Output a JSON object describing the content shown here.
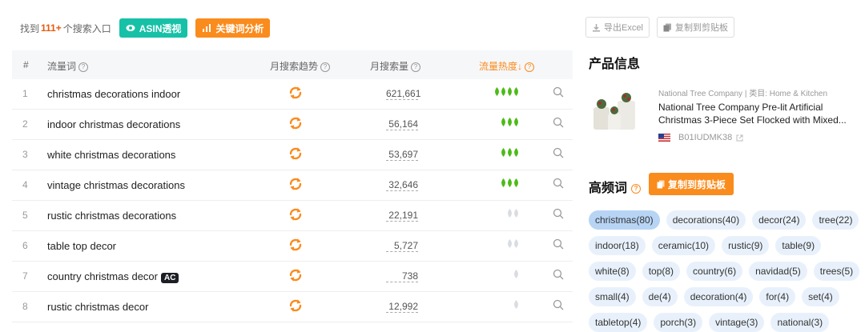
{
  "summary": {
    "prefix": "找到",
    "count": "111+",
    "suffix": "个搜索入口"
  },
  "buttons": {
    "asin": "ASIN透视",
    "keyword": "关键词分析",
    "export": "导出Excel",
    "copy": "复制到剪贴板"
  },
  "table": {
    "headers": {
      "idx": "#",
      "keyword": "流量词",
      "trend": "月搜索趋势",
      "volume": "月搜索量",
      "heat": "流量热度↓"
    },
    "rows": [
      {
        "idx": "1",
        "keyword": "christmas decorations indoor",
        "volume": "621,661",
        "heat": 4,
        "badge": ""
      },
      {
        "idx": "2",
        "keyword": "indoor christmas decorations",
        "volume": "56,164",
        "heat": 3,
        "badge": ""
      },
      {
        "idx": "3",
        "keyword": "white christmas decorations",
        "volume": "53,697",
        "heat": 3,
        "badge": ""
      },
      {
        "idx": "4",
        "keyword": "vintage christmas decorations",
        "volume": "32,646",
        "heat": 3,
        "badge": ""
      },
      {
        "idx": "5",
        "keyword": "rustic christmas decorations",
        "volume": "22,191",
        "heat": 2,
        "badge": ""
      },
      {
        "idx": "6",
        "keyword": "table top decor",
        "volume": "5,727",
        "heat": 2,
        "badge": ""
      },
      {
        "idx": "7",
        "keyword": "country christmas decor",
        "volume": "738",
        "heat": 1,
        "badge": "AC"
      },
      {
        "idx": "8",
        "keyword": "rustic christmas decor",
        "volume": "12,992",
        "heat": 1,
        "badge": ""
      }
    ]
  },
  "product": {
    "section_title": "产品信息",
    "meta": "National Tree Company | 类目: Home & Kitchen",
    "title": "National Tree Company Pre-lit Artificial Christmas 3-Piece Set Flocked with Mixed...",
    "asin": "B01IUDMK38"
  },
  "high_freq": {
    "section_title": "高频词",
    "copy_label": "复制到剪贴板",
    "tags": [
      "christmas(80)",
      "decorations(40)",
      "decor(24)",
      "tree(22)",
      "indoor(18)",
      "ceramic(10)",
      "rustic(9)",
      "table(9)",
      "white(8)",
      "top(8)",
      "country(6)",
      "navidad(5)",
      "trees(5)",
      "small(4)",
      "de(4)",
      "decoration(4)",
      "for(4)",
      "set(4)",
      "tabletop(4)",
      "porch(3)",
      "vintage(3)",
      "national(3)"
    ]
  },
  "colors": {
    "accent_orange": "#fa8b1d",
    "accent_teal": "#16c1a7",
    "heat_green": "#4cbb17",
    "heat_gray": "#d9dde2",
    "tag_bg": "#e8f1fb",
    "tag_bg_highlight": "#b7d4f5"
  }
}
